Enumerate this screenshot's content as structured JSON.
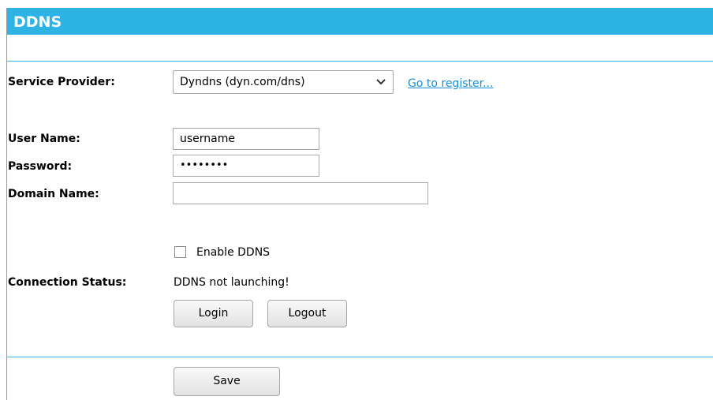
{
  "header": {
    "title": "DDNS"
  },
  "service_provider": {
    "label": "Service Provider:",
    "selected": "Dyndns (dyn.com/dns)",
    "register_link": "Go to register..."
  },
  "user_name": {
    "label": "User Name:",
    "value": "username"
  },
  "password": {
    "label": "Password:",
    "value": "••••••••"
  },
  "domain_name": {
    "label": "Domain Name:",
    "value": ""
  },
  "enable_ddns": {
    "label": "Enable DDNS",
    "checked": false
  },
  "connection_status": {
    "label": "Connection Status:",
    "value": "DDNS not launching!"
  },
  "buttons": {
    "login": "Login",
    "logout": "Logout",
    "save": "Save"
  },
  "colors": {
    "header_bar": "#2db3e4",
    "link": "#1a8fd6"
  },
  "icons": {
    "select_arrow": "chevron-down-icon"
  }
}
